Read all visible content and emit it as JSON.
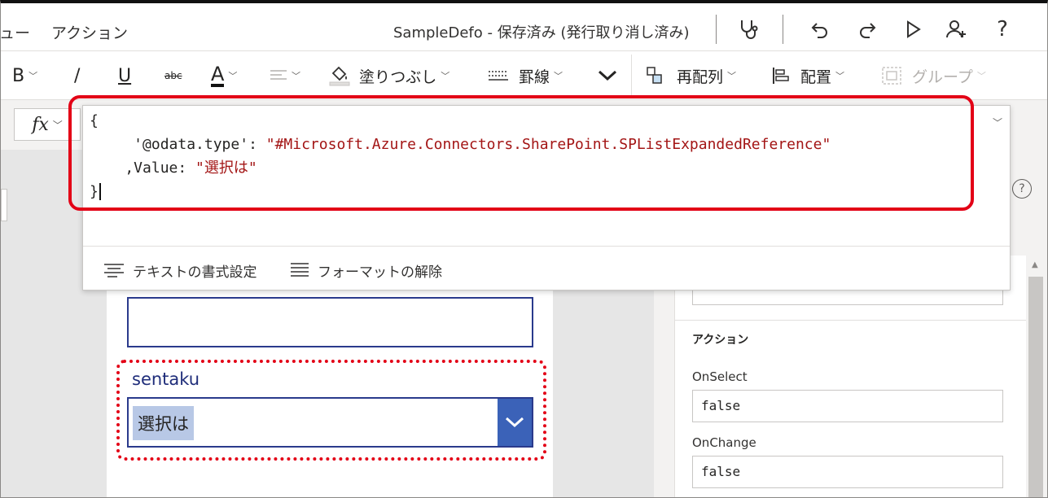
{
  "titlebar": {
    "menu_partial": "ュー",
    "menu_action": "アクション",
    "doc_title": "SampleDefo - 保存済み (発行取り消し済み)"
  },
  "ribbon": {
    "bold": "B",
    "italic": "/",
    "underline": "U",
    "strike": "abc",
    "font_color": "A",
    "fill": "塗りつぶし",
    "border": "罫線",
    "reorder": "再配列",
    "align": "配置",
    "group": "グループ"
  },
  "formula_bar": {
    "fx_label": "fx",
    "code_lines": [
      "{",
      "     '@odata.type': ",
      "\"#Microsoft.Azure.Connectors.SharePoint.SPListExpandedReference\"",
      "    ,Value: ",
      "\"選択は\"",
      "}"
    ],
    "format_text": "テキストの書式設定",
    "remove_format": "フォーマットの解除"
  },
  "canvas": {
    "field_label": "sentaku",
    "dropdown_value": "選択は"
  },
  "properties": {
    "section_title": "アクション",
    "on_select_label": "OnSelect",
    "on_select_value": "false",
    "on_change_label": "OnChange",
    "on_change_value": "false"
  },
  "colors": {
    "highlight": "#e30016",
    "dropdown_accent": "#3b62b8",
    "string_literal": "#a31515"
  }
}
